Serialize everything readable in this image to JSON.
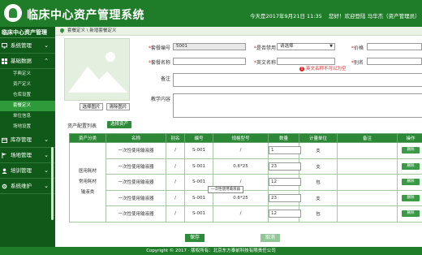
{
  "header": {
    "title": "临床中心资产管理系统",
    "today": "今天是2017年9月21日  11:35",
    "welcome": "您好！欢迎登陆  马华杰（资产管理员）"
  },
  "sidebar": {
    "title": "临床中心资产管理",
    "items": [
      {
        "label": "系统管理"
      },
      {
        "label": "基础数据"
      },
      {
        "label": "库存管理"
      },
      {
        "label": "场地管理"
      },
      {
        "label": "培训管理"
      },
      {
        "label": "系统维护"
      }
    ],
    "subitems": [
      {
        "label": "字典定义"
      },
      {
        "label": "资产定义"
      },
      {
        "label": "仓库设置"
      },
      {
        "label": "套餐定义"
      },
      {
        "label": "单位信息"
      },
      {
        "label": "场地设置"
      }
    ]
  },
  "breadcrumb": "套餐定义 \\ 新增套餐定义",
  "photo": {
    "select_label": "选择图片",
    "clear_label": "清除图片"
  },
  "form": {
    "code_label": "套餐编号",
    "code_value": "5001",
    "enabled_label": "是否禁用",
    "enabled_value": "请选择",
    "price_label": "价格",
    "name_label": "套餐名称",
    "en_name_label": "英文名称",
    "alias_label": "别名",
    "en_name_error": "英文名称不可以为空",
    "remark_label": "备注",
    "content_label": "教学内容"
  },
  "list": {
    "label": "资产配置列表",
    "select_button": "选择资产"
  },
  "table": {
    "headers": [
      "资产分类",
      "名称",
      "别名",
      "编号",
      "规格型号",
      "数量",
      "计量单位",
      "备注",
      "操作"
    ],
    "category": [
      "医用耗材",
      "常用耗材",
      "输液类"
    ],
    "rows": [
      {
        "name": "一次性使用输液器",
        "alias": "/",
        "code": "S-001",
        "spec": "/",
        "qty": "1",
        "unit": "支",
        "remark": "",
        "action": "删除"
      },
      {
        "name": "一次性使用输液器",
        "alias": "/",
        "code": "S-001",
        "spec": "0.6*25",
        "qty": "23",
        "unit": "支",
        "remark": "",
        "action": "删除"
      },
      {
        "name": "一次性使用输液器",
        "alias": "/",
        "code": "S-001",
        "spec": "/",
        "qty": "12",
        "unit": "包",
        "remark": "",
        "action": "删除"
      },
      {
        "name": "一次性使用输液器",
        "alias": "/",
        "code": "S-001",
        "spec": "0.6*25",
        "qty": "23",
        "unit": "支",
        "remark": "",
        "action": "删除"
      },
      {
        "name": "一次性使用输液器",
        "alias": "/",
        "code": "S-001",
        "spec": "/",
        "qty": "12",
        "unit": "包",
        "remark": "",
        "action": "删除"
      }
    ],
    "tooltip": "一次性使用输液器"
  },
  "actions": {
    "save": "保存",
    "cancel": "取消"
  },
  "footer": "Copyright © 2017 · 版权所有：北京东方泰前科技有限责任公司",
  "colors": {
    "header": "#1f7d2a",
    "sidebar": "#0f5a18",
    "active": "#2e9a3a",
    "error": "#d22222"
  }
}
